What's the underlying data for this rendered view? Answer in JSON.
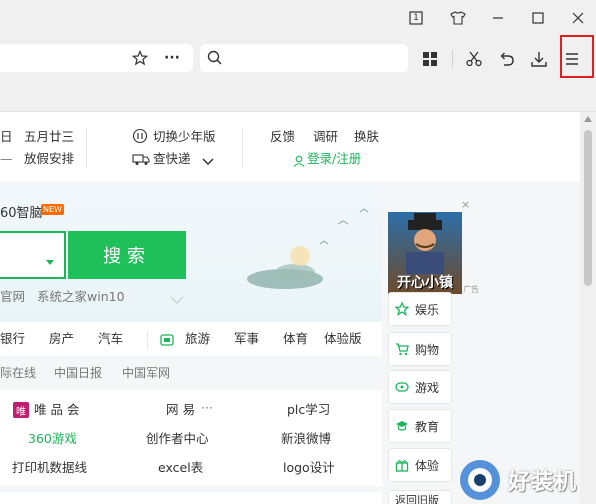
{
  "window": {
    "title_badge": "1",
    "controls": [
      "minimize",
      "maximize",
      "close"
    ]
  },
  "toolbar": {
    "bookmark_icon": "star-icon",
    "more_label": "···",
    "search_placeholder": ""
  },
  "header": {
    "date_line1": "日",
    "lunar_line1": "五月廿三",
    "date_line2": "—",
    "lunar_line2": "放假安排",
    "youth_mode": "切换少年版",
    "express": "查快递",
    "feedback": "反馈",
    "tune": "调研",
    "skin": "换肤",
    "login": "登录/注册"
  },
  "search_card": {
    "brand": "60智脑",
    "new_badge": "NEW",
    "search_button": "搜索",
    "hint1": "官网",
    "hint2": "系统之家win10"
  },
  "categories": [
    "银行",
    "房产",
    "汽车",
    "旅游",
    "军事",
    "体育",
    "体验版"
  ],
  "news_links": [
    "际在线",
    "中国日报",
    "中国军网"
  ],
  "sites": {
    "rows": [
      [
        "唯 品 会",
        "网 易",
        "plc学习"
      ],
      [
        "360游戏",
        "创作者中心",
        "新浪微博"
      ],
      [
        "打印机数据线",
        "excel表",
        "logo设计"
      ]
    ],
    "more": "···"
  },
  "ad": {
    "title": "开心小镇",
    "tag": "广告"
  },
  "side_menu": [
    "娱乐",
    "购物",
    "游戏",
    "教育",
    "体验",
    "返回旧版"
  ],
  "watermark": "好装机"
}
